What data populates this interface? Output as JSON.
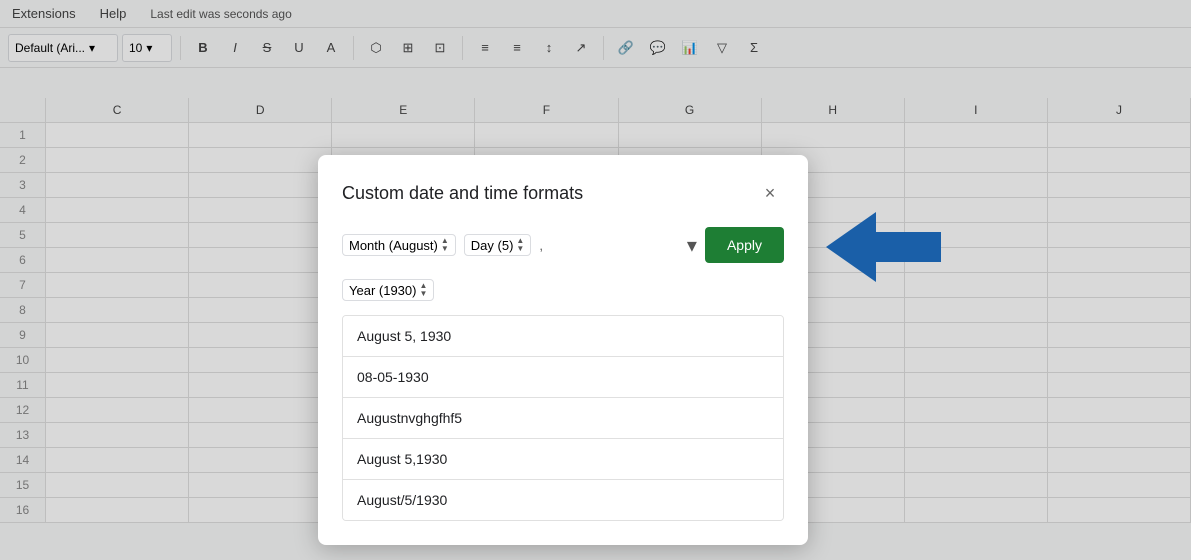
{
  "menubar": {
    "items": [
      "Extensions",
      "Help"
    ],
    "last_edit": "Last edit was seconds ago"
  },
  "toolbar": {
    "font_name": "Default (Ari...",
    "font_size": "10",
    "bold_label": "B",
    "italic_label": "I",
    "strikethrough_label": "S"
  },
  "columns": [
    "C",
    "D",
    "E",
    "F",
    "G",
    "H",
    "I",
    "J"
  ],
  "dialog": {
    "title": "Custom date and time formats",
    "close_label": "×",
    "format_chips": {
      "month": "Month (August)",
      "day": "Day (5)",
      "separator": ",",
      "year": "Year (1930)"
    },
    "apply_label": "Apply",
    "preview_items": [
      "August 5, 1930",
      "08-05-1930",
      "Augustnvghgfhf5",
      "August 5,1930",
      "August/5/1930"
    ]
  }
}
